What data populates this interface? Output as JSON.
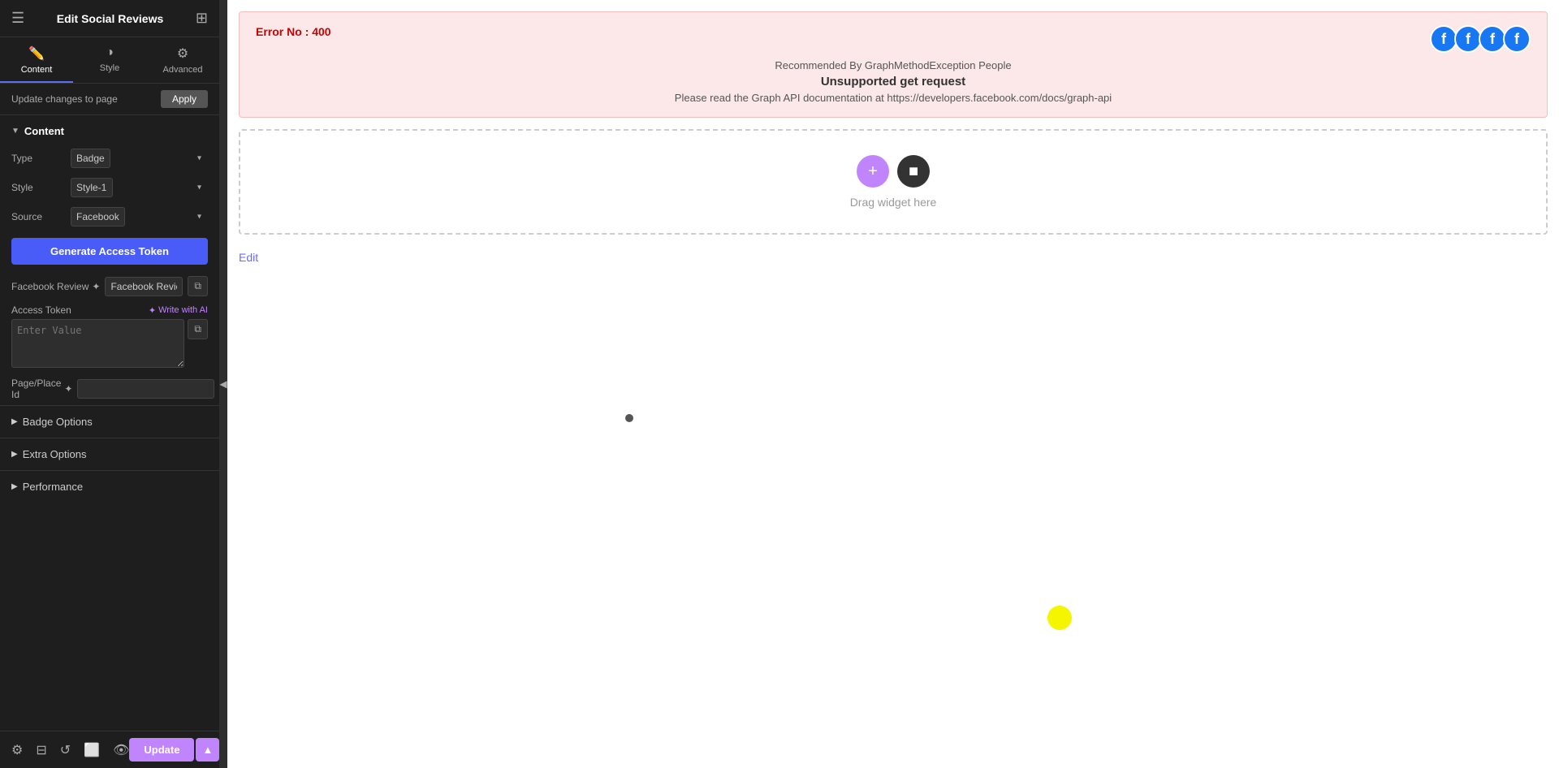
{
  "sidebar": {
    "title": "Edit Social Reviews",
    "tabs": [
      {
        "label": "Content",
        "icon": "✏️",
        "active": true
      },
      {
        "label": "Style",
        "icon": "◑",
        "active": false
      },
      {
        "label": "Advanced",
        "icon": "⚙",
        "active": false
      }
    ],
    "update_text": "Update changes to page",
    "apply_label": "Apply",
    "content_section": "Content",
    "type_label": "Type",
    "type_value": "Badge",
    "style_label": "Style",
    "style_value": "Style-1",
    "source_label": "Source",
    "source_value": "Facebook",
    "generate_btn": "Generate Access Token",
    "fb_review_label": "Facebook Review",
    "fb_review_value": "Facebook Reviews",
    "access_token_label": "Access Token",
    "write_ai_label": "Write with AI",
    "access_token_placeholder": "Enter Value",
    "page_place_label": "Page/Place Id",
    "badge_options_label": "Badge Options",
    "extra_options_label": "Extra Options",
    "performance_label": "Performance",
    "update_footer_btn": "Update"
  },
  "main": {
    "error": {
      "number": "Error No : 400",
      "recommended": "Recommended By GraphMethodException People",
      "unsupported": "Unsupported get request",
      "please_read": "Please read the Graph API documentation at https://developers.facebook.com/docs/graph-api"
    },
    "drag_widget_text": "Drag widget here",
    "edit_link": "Edit"
  }
}
